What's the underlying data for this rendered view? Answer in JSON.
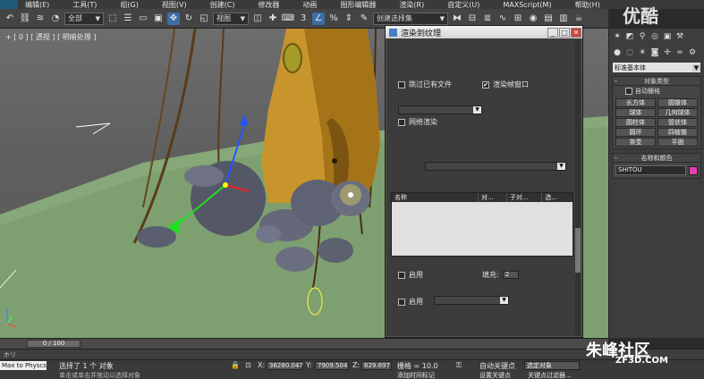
{
  "menubar": {
    "items": [
      "编辑(E)",
      "工具(T)",
      "组(G)",
      "视图(V)",
      "创建(C)",
      "修改器",
      "动画",
      "图形编辑器",
      "渲染(R)",
      "自定义(U)",
      "MAXScript(M)",
      "帮助(H)"
    ]
  },
  "toolbar": {
    "selection_filter": "全部",
    "ref_coord": "视图",
    "named_sel": "创建选择集"
  },
  "watermark": {
    "top": "优酷",
    "bottom": "朱峰社区",
    "bottom_sub": "ZF3D.COM"
  },
  "viewport": {
    "label": "+ [ 0 ] [ 透视 ] [ 明暗处理 ]"
  },
  "dialog": {
    "title": "渲染到纹理",
    "skip_existing_label": "跳过已有文件",
    "render_frame_window_label": "渲染帧窗口",
    "render_frame_window_checked": "✔",
    "network_render_label": "网络渲染",
    "list_columns": [
      "名称",
      "对...",
      "子对...",
      "选..."
    ],
    "enable_label_1": "启用",
    "padding_label": "填充:",
    "padding_value": "2",
    "enable_label_2": "启用"
  },
  "cmdpanel": {
    "category_dropdown": "标准基本体",
    "object_type_title": "对象类型",
    "auto_grid_label": "自动栅格",
    "primitives": [
      "长方体",
      "圆锥体",
      "球体",
      "几何球体",
      "圆柱体",
      "管状体",
      "圆环",
      "四棱锥",
      "茶壶",
      "平面"
    ],
    "name_color_title": "名称和颜色",
    "object_name": "SHITOU",
    "object_color": "#e040b0"
  },
  "timeline": {
    "frame_range": "0 / 100"
  },
  "track": {
    "label": "ホリ"
  },
  "status": {
    "maxscript": "Max to Physcs",
    "selected": "选择了 1 个 对象",
    "x_label": "X:",
    "x_value": "36280.047",
    "y_label": "Y:",
    "y_value": "7909.504",
    "z_label": "Z:",
    "z_value": "629.697",
    "grid_label": "栅格 = 10.0",
    "auto_key_label": "自动关键点",
    "selected_obj_dropdown": "选定对象",
    "set_key_label": "设置关键点",
    "key_filters_label": "关键点过滤器...",
    "prompt": "单击或单击并拖动以选择对象",
    "add_time_tag": "添加时间标记"
  }
}
